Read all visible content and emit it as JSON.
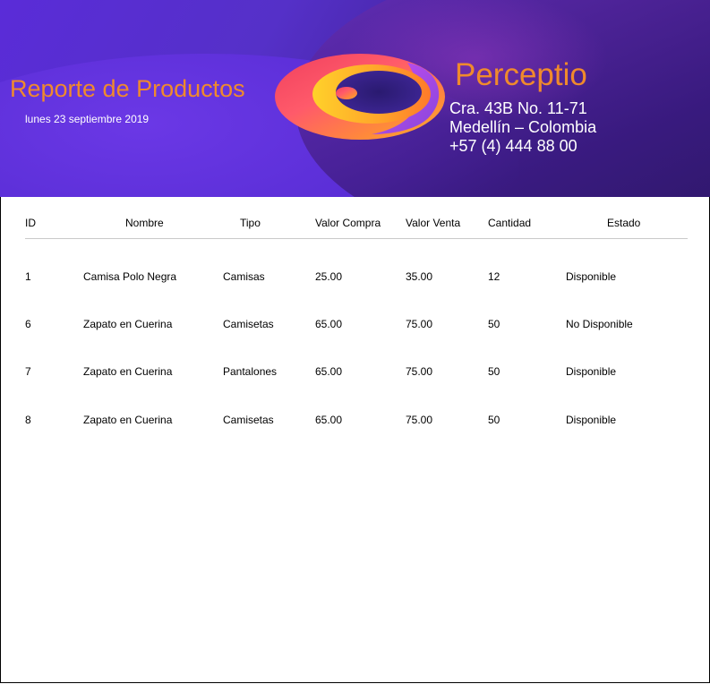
{
  "header": {
    "title": "Reporte de Productos",
    "date": "lunes 23 septiembre 2019",
    "company": "Perceptio",
    "address": [
      "Cra. 43B No. 11-71",
      "Medellín – Colombia",
      "+57 (4) 444 88 00"
    ],
    "accent_color": "#f08a2c",
    "background_color": "#5a2cd8"
  },
  "table": {
    "columns": [
      "ID",
      "Nombre",
      "Tipo",
      "Valor Compra",
      "Valor Venta",
      "Cantidad",
      "Estado"
    ],
    "rows": [
      [
        "1",
        "Camisa Polo Negra",
        "Camisas",
        "25.00",
        "35.00",
        "12",
        "Disponible"
      ],
      [
        "6",
        "Zapato en Cuerina",
        "Camisetas",
        "65.00",
        "75.00",
        "50",
        "No Disponible"
      ],
      [
        "7",
        "Zapato en Cuerina",
        "Pantalones",
        "65.00",
        "75.00",
        "50",
        "Disponible"
      ],
      [
        "8",
        "Zapato en Cuerina",
        "Camisetas",
        "65.00",
        "75.00",
        "50",
        "Disponible"
      ]
    ]
  }
}
